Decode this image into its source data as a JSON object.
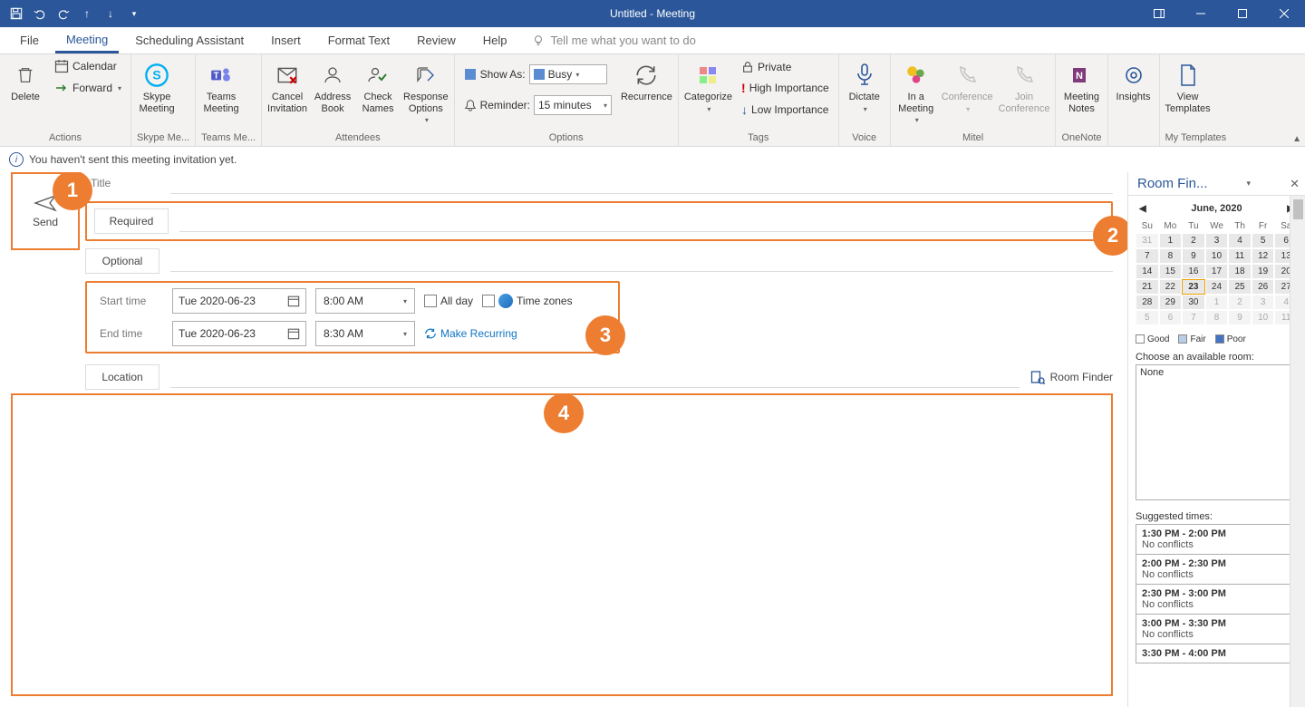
{
  "window": {
    "title": "Untitled  -  Meeting"
  },
  "tabs": {
    "file": "File",
    "meeting": "Meeting",
    "scheduling": "Scheduling Assistant",
    "insert": "Insert",
    "format": "Format Text",
    "review": "Review",
    "help": "Help",
    "tellme": "Tell me what you want to do"
  },
  "ribbon": {
    "actions": {
      "label": "Actions",
      "delete": "Delete",
      "calendar": "Calendar",
      "forward": "Forward"
    },
    "skype": {
      "label": "Skype Me...",
      "btn": "Skype\nMeeting"
    },
    "teams": {
      "label": "Teams Me...",
      "btn": "Teams\nMeeting"
    },
    "attendees": {
      "label": "Attendees",
      "cancel": "Cancel\nInvitation",
      "addrbook": "Address\nBook",
      "check": "Check\nNames",
      "response": "Response\nOptions"
    },
    "options": {
      "label": "Options",
      "showas_label": "Show As:",
      "showas_value": "Busy",
      "reminder_label": "Reminder:",
      "reminder_value": "15 minutes",
      "recurrence": "Recurrence"
    },
    "tags": {
      "label": "Tags",
      "categorize": "Categorize",
      "private": "Private",
      "high": "High Importance",
      "low": "Low Importance"
    },
    "voice": {
      "label": "Voice",
      "dictate": "Dictate"
    },
    "mitel": {
      "label": "Mitel",
      "inmeeting": "In a\nMeeting",
      "conference": "Conference",
      "join": "Join\nConference"
    },
    "onenote": {
      "label": "OneNote",
      "notes": "Meeting\nNotes"
    },
    "insights": {
      "label": "",
      "btn": "Insights"
    },
    "templates": {
      "label": "My Templates",
      "btn": "View\nTemplates"
    }
  },
  "infobar": {
    "text": "You haven't sent this meeting invitation yet."
  },
  "compose": {
    "send": "Send",
    "title_label": "Title",
    "required_label": "Required",
    "optional_label": "Optional",
    "start_label": "Start time",
    "end_label": "End time",
    "start_date": "Tue 2020-06-23",
    "start_time": "8:00 AM",
    "end_date": "Tue 2020-06-23",
    "end_time": "8:30 AM",
    "allday": "All day",
    "tz": "Time zones",
    "recurring": "Make Recurring",
    "location_label": "Location",
    "room_finder_btn": "Room Finder"
  },
  "callouts": {
    "c1": "1",
    "c2": "2",
    "c3": "3",
    "c4": "4"
  },
  "room": {
    "title": "Room Fin...",
    "month": "June, 2020",
    "dow": [
      "Su",
      "Mo",
      "Tu",
      "We",
      "Th",
      "Fr",
      "Sa"
    ],
    "weeks": [
      [
        "31",
        "1",
        "2",
        "3",
        "4",
        "5",
        "6"
      ],
      [
        "7",
        "8",
        "9",
        "10",
        "11",
        "12",
        "13"
      ],
      [
        "14",
        "15",
        "16",
        "17",
        "18",
        "19",
        "20"
      ],
      [
        "21",
        "22",
        "23",
        "24",
        "25",
        "26",
        "27"
      ],
      [
        "28",
        "29",
        "30",
        "1",
        "2",
        "3",
        "4"
      ],
      [
        "5",
        "6",
        "7",
        "8",
        "9",
        "10",
        "11"
      ]
    ],
    "legend": {
      "good": "Good",
      "fair": "Fair",
      "poor": "Poor"
    },
    "choose_label": "Choose an available room:",
    "room_none": "None",
    "suggested_label": "Suggested times:",
    "suggestions": [
      {
        "time": "1:30 PM - 2:00 PM",
        "sub": "No conflicts"
      },
      {
        "time": "2:00 PM - 2:30 PM",
        "sub": "No conflicts"
      },
      {
        "time": "2:30 PM - 3:00 PM",
        "sub": "No conflicts"
      },
      {
        "time": "3:00 PM - 3:30 PM",
        "sub": "No conflicts"
      },
      {
        "time": "3:30 PM - 4:00 PM",
        "sub": ""
      }
    ]
  }
}
